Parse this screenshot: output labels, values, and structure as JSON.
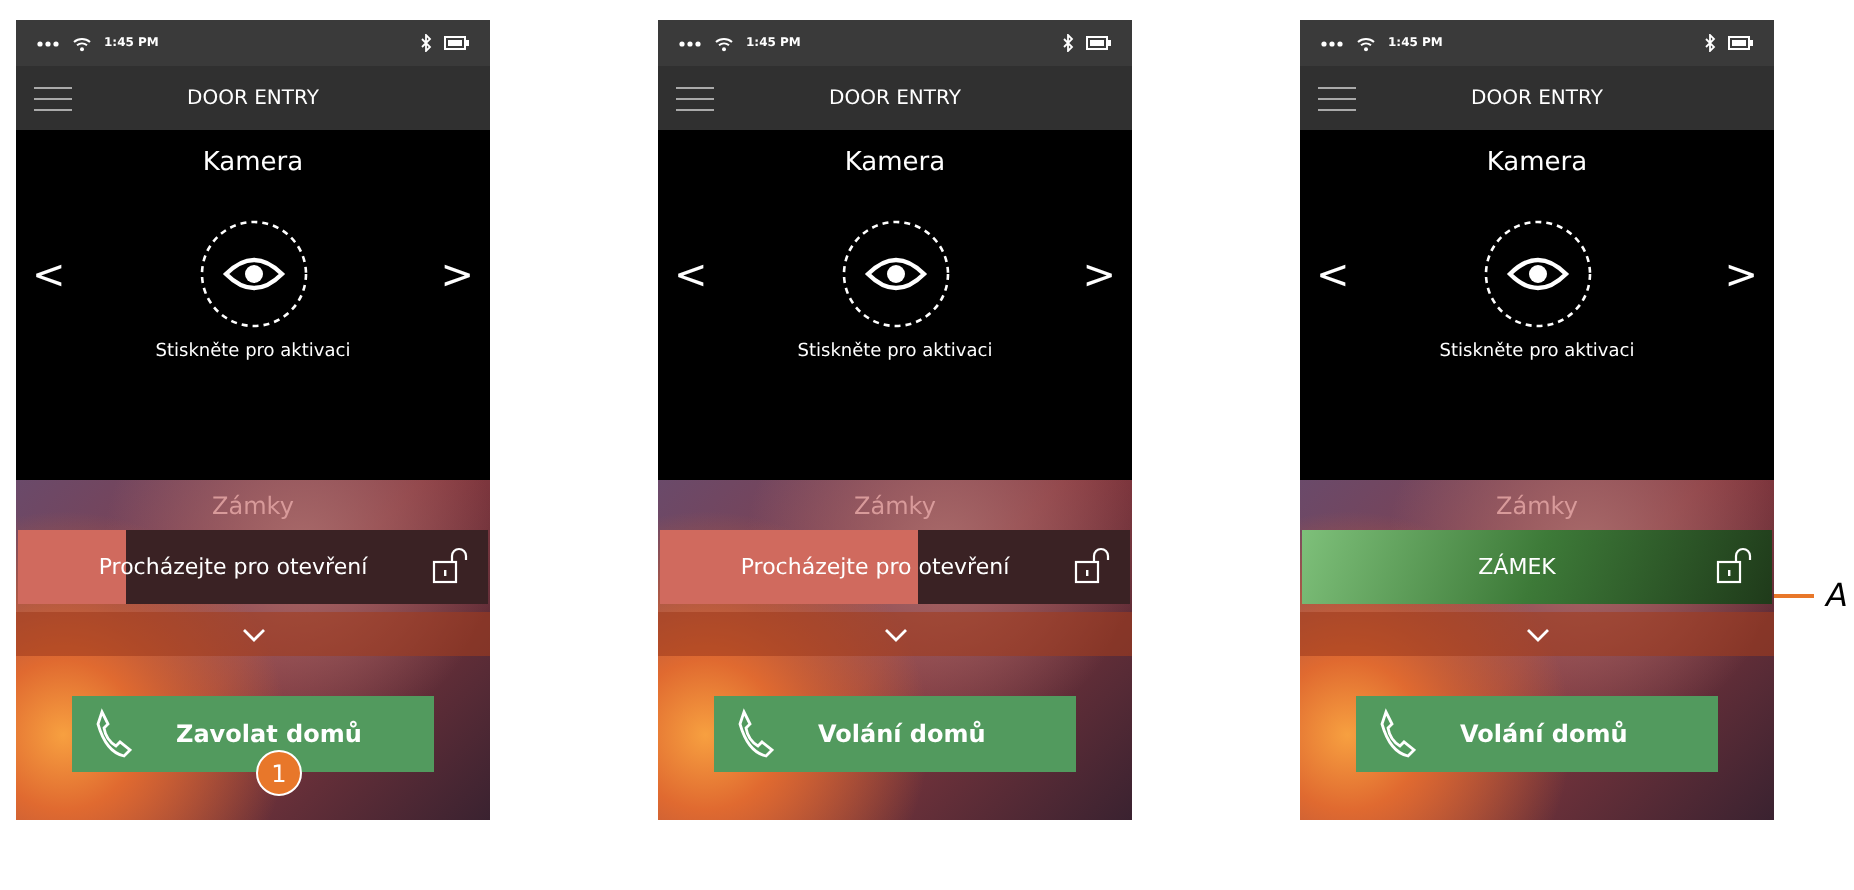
{
  "phones": [
    {
      "status_bar": {
        "time": "1:45 PM"
      },
      "title": "DOOR ENTRY",
      "camera": {
        "label": "Kamera",
        "hint": "Stiskněte pro aktivaci",
        "prev": "<",
        "next": ">"
      },
      "locks": {
        "heading": "Zámky",
        "slider": {
          "kind": "swipe",
          "label": "Procházejte pro otevření",
          "level": 0.23
        }
      },
      "call_button": "Zavolat domů",
      "step_badge": "1"
    },
    {
      "status_bar": {
        "time": "1:45 PM"
      },
      "title": "DOOR ENTRY",
      "camera": {
        "label": "Kamera",
        "hint": "Stiskněte pro aktivaci",
        "prev": "<",
        "next": ">"
      },
      "locks": {
        "heading": "Zámky",
        "slider": {
          "kind": "swipe",
          "label": "Procházejte pro otevření",
          "level": 0.55
        }
      },
      "call_button": "Volání domů"
    },
    {
      "status_bar": {
        "time": "1:45 PM"
      },
      "title": "DOOR ENTRY",
      "camera": {
        "label": "Kamera",
        "hint": "Stiskněte pro aktivaci",
        "prev": "<",
        "next": ">"
      },
      "locks": {
        "heading": "Zámky",
        "slider": {
          "kind": "unlocked",
          "label": "ZÁMEK",
          "level": 1
        }
      },
      "call_button": "Volání domů",
      "callout": "A"
    }
  ]
}
